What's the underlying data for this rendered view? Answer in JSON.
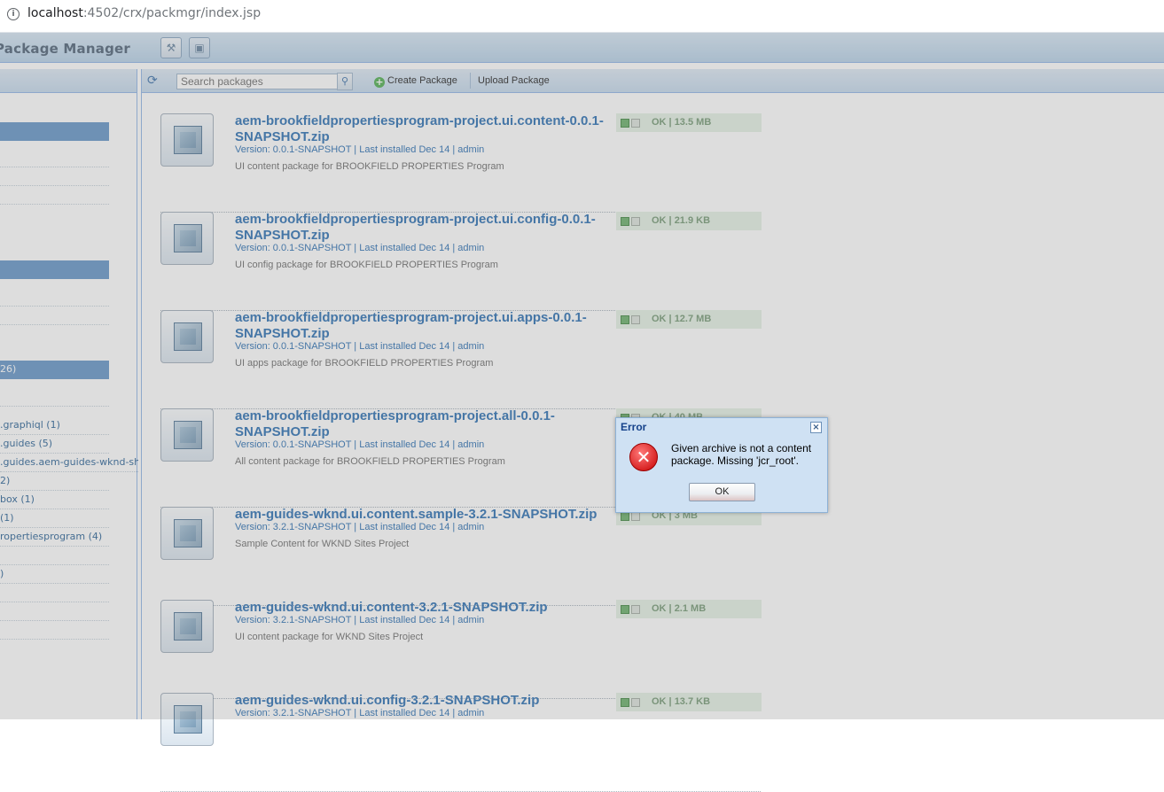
{
  "browser": {
    "url_host": "localhost",
    "url_rest": ":4502/crx/packmgr/index.jsp"
  },
  "header": {
    "title": "Package Manager"
  },
  "toolbar": {
    "search_placeholder": "Search packages",
    "create_label": "Create Package",
    "upload_label": "Upload Package"
  },
  "tree": {
    "items": [
      {
        "label": "",
        "selected": true
      },
      {
        "label": "",
        "selected": false
      },
      {
        "label": "",
        "selected": false
      },
      {
        "label": "",
        "selected": false
      },
      {
        "label": "",
        "selected": true
      },
      {
        "label": "",
        "selected": false
      },
      {
        "label": "",
        "selected": false
      },
      {
        "label": "26)",
        "selected": true
      },
      {
        "label": "",
        "selected": false
      },
      {
        "label": ".graphiql (1)",
        "selected": false
      },
      {
        "label": ".guides (5)",
        "selected": false
      },
      {
        "label": ".guides.aem-guides-wknd-shared",
        "selected": false
      },
      {
        "label": "2)",
        "selected": false
      },
      {
        "label": "box (1)",
        "selected": false
      },
      {
        "label": "(1)",
        "selected": false
      },
      {
        "label": "ropertiesprogram (4)",
        "selected": false
      },
      {
        "label": "",
        "selected": false
      },
      {
        "label": ")",
        "selected": false
      },
      {
        "label": "",
        "selected": false
      },
      {
        "label": "",
        "selected": false
      },
      {
        "label": "",
        "selected": false
      }
    ]
  },
  "packages": [
    {
      "name": "aem-brookfieldpropertiesprogram-project.ui.content-0.0.1-SNAPSHOT.zip",
      "meta": "Version: 0.0.1-SNAPSHOT | Last installed Dec 14 | admin",
      "desc": "UI content package for BROOKFIELD PROPERTIES Program",
      "status": "OK  |  13.5 MB"
    },
    {
      "name": "aem-brookfieldpropertiesprogram-project.ui.config-0.0.1-SNAPSHOT.zip",
      "meta": "Version: 0.0.1-SNAPSHOT | Last installed Dec 14 | admin",
      "desc": "UI config package for BROOKFIELD PROPERTIES Program",
      "status": "OK  |  21.9 KB"
    },
    {
      "name": "aem-brookfieldpropertiesprogram-project.ui.apps-0.0.1-SNAPSHOT.zip",
      "meta": "Version: 0.0.1-SNAPSHOT | Last installed Dec 14 | admin",
      "desc": "UI apps package for BROOKFIELD PROPERTIES Program",
      "status": "OK  |  12.7 MB"
    },
    {
      "name": "aem-brookfieldpropertiesprogram-project.all-0.0.1-SNAPSHOT.zip",
      "meta": "Version: 0.0.1-SNAPSHOT | Last installed Dec 14 | admin",
      "desc": "All content package for BROOKFIELD PROPERTIES Program",
      "status": "OK  |  40 MB"
    },
    {
      "name": "aem-guides-wknd.ui.content.sample-3.2.1-SNAPSHOT.zip",
      "meta": "Version: 3.2.1-SNAPSHOT | Last installed Dec 14 | admin",
      "desc": "Sample Content for WKND Sites Project",
      "status": "OK  |  3 MB"
    },
    {
      "name": "aem-guides-wknd.ui.content-3.2.1-SNAPSHOT.zip",
      "meta": "Version: 3.2.1-SNAPSHOT | Last installed Dec 14 | admin",
      "desc": "UI content package for WKND Sites Project",
      "status": "OK  |  2.1 MB"
    },
    {
      "name": "aem-guides-wknd.ui.config-3.2.1-SNAPSHOT.zip",
      "meta": "Version: 3.2.1-SNAPSHOT | Last installed Dec 14 | admin",
      "desc": "",
      "status": "OK  |  13.7 KB"
    }
  ],
  "dialog": {
    "title": "Error",
    "message": "Given archive is not a content package. Missing 'jcr_root'.",
    "ok_label": "OK",
    "close_glyph": "×",
    "error_glyph": "✕"
  }
}
